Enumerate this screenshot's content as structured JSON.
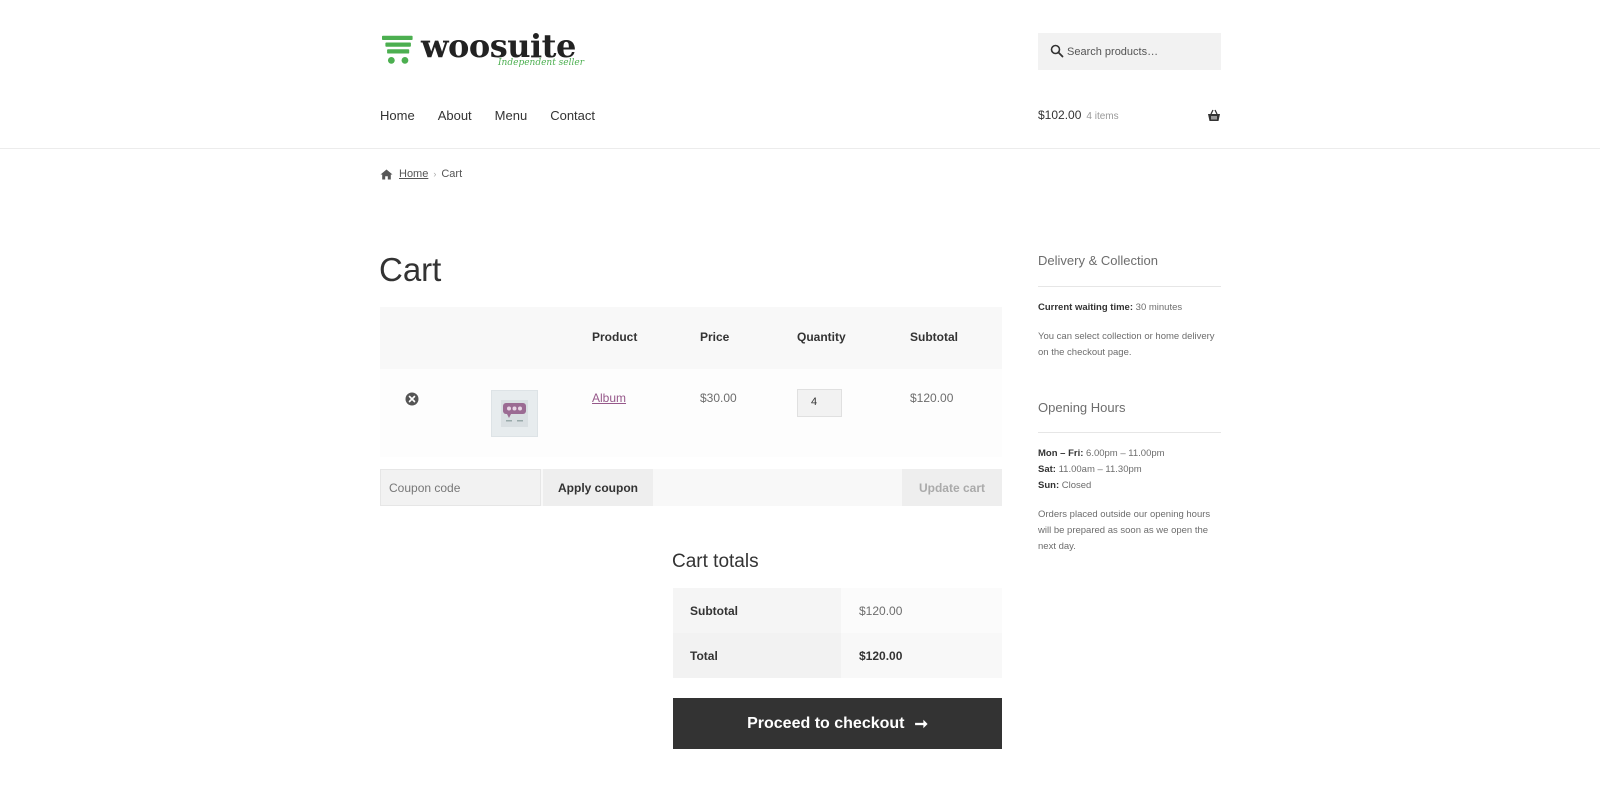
{
  "brand": {
    "name": "woosuite",
    "tagline": "Independent seller",
    "accent_color": "#4caf50"
  },
  "search": {
    "placeholder": "Search products…",
    "icon": "search-icon"
  },
  "nav": {
    "items": [
      "Home",
      "About",
      "Menu",
      "Contact"
    ]
  },
  "mini_cart": {
    "total": "$102.00",
    "count": "4 items",
    "icon": "basket-icon"
  },
  "breadcrumb": {
    "home": "Home",
    "separator": "›",
    "current": "Cart"
  },
  "page": {
    "title": "Cart"
  },
  "cart": {
    "columns": [
      "Product",
      "Price",
      "Quantity",
      "Subtotal"
    ],
    "items": [
      {
        "product": "Album",
        "price": "$30.00",
        "quantity": "4",
        "subtotal": "$120.00"
      }
    ],
    "coupon_placeholder": "Coupon code",
    "apply_coupon": "Apply coupon",
    "update_cart": "Update cart"
  },
  "totals": {
    "title": "Cart totals",
    "subtotal_label": "Subtotal",
    "subtotal_value": "$120.00",
    "total_label": "Total",
    "total_value": "$120.00",
    "checkout_label": "Proceed to checkout",
    "checkout_arrow": "➞"
  },
  "sidebar": {
    "delivery_title": "Delivery & Collection",
    "waiting_label": "Current waiting time:",
    "waiting_value": "30 minutes",
    "delivery_note": "You can select collection or home delivery on the checkout page.",
    "hours_title": "Opening Hours",
    "hours": [
      {
        "day": "Mon – Fri:",
        "time": "6.00pm – 11.00pm"
      },
      {
        "day": "Sat:",
        "time": "11.00am – 11.30pm"
      },
      {
        "day": "Sun:",
        "time": "Closed"
      }
    ],
    "hours_note": "Orders placed outside our opening hours will be prepared as soon as we open the next day."
  }
}
